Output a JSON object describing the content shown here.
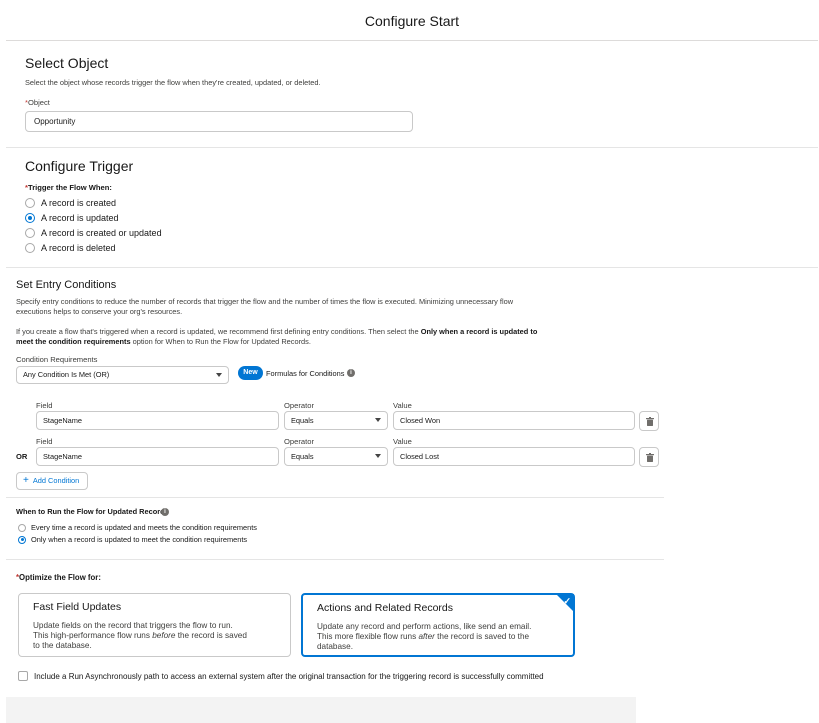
{
  "header": {
    "title": "Configure Start"
  },
  "select_object": {
    "title": "Select Object",
    "description": "Select the object whose records trigger the flow when they're created, updated, or deleted.",
    "object_label": "Object",
    "required_marker": "*",
    "object_value": "Opportunity"
  },
  "configure_trigger": {
    "title": "Configure Trigger",
    "label": "Trigger the Flow When:",
    "required_marker": "*",
    "options": [
      {
        "label": "A record is created",
        "selected": false
      },
      {
        "label": "A record is updated",
        "selected": true
      },
      {
        "label": "A record is created or updated",
        "selected": false
      },
      {
        "label": "A record is deleted",
        "selected": false
      }
    ]
  },
  "entry_conditions": {
    "title": "Set Entry Conditions",
    "desc1_line1": "Specify entry conditions to reduce the number of records that trigger the flow and the number of times the flow is executed. Minimizing unnecessary flow",
    "desc1_line2": "executions helps to conserve your org's resources.",
    "desc2_line1_pre": "If you create a flow that's triggered when a record is updated, we recommend first defining entry conditions. Then select the ",
    "desc2_line1_bold": "Only when a record is updated to",
    "desc2_line2_bold": "meet the condition requirements",
    "desc2_line2_post": " option for When to Run the Flow for Updated Records.",
    "requirements_label": "Condition Requirements",
    "requirements_value": "Any Condition Is Met (OR)",
    "new_badge": "New",
    "formulas_label": "Formulas for Conditions",
    "info_icon": "i",
    "field_label": "Field",
    "operator_label": "Operator",
    "value_label": "Value",
    "conditions": [
      {
        "field": "StageName",
        "operator": "Equals",
        "value": "Closed Won",
        "prefix": ""
      },
      {
        "field": "StageName",
        "operator": "Equals",
        "value": "Closed Lost",
        "prefix": "OR"
      }
    ],
    "add_condition": "Add Condition",
    "add_icon": "+"
  },
  "when_to_run": {
    "title": "When to Run the Flow for Updated Records",
    "info_icon": "i",
    "options": [
      {
        "label": "Every time a record is updated and meets the condition requirements",
        "selected": false
      },
      {
        "label": "Only when a record is updated to meet the condition requirements",
        "selected": true
      }
    ]
  },
  "optimize": {
    "label": "Optimize the Flow for:",
    "required_marker": "*",
    "cards": [
      {
        "title": "Fast Field Updates",
        "line1": "Update fields on the record that triggers the flow to run.",
        "line2_pre": "This high-performance flow runs ",
        "line2_em": "before",
        "line2_post": " the record is saved",
        "line3": "to the database.",
        "selected": false
      },
      {
        "title": "Actions and Related Records",
        "line1": "Update any record and perform actions, like send an email.",
        "line2_pre": "This more flexible flow runs ",
        "line2_em": "after",
        "line2_post": " the record is saved to the",
        "line3": "database.",
        "selected": true
      }
    ],
    "check_icon": "✓"
  },
  "async": {
    "label": "Include a Run Asynchronously path to access an external system after the original transaction for the triggering record is successfully committed",
    "checked": false
  },
  "colors": {
    "brand": "#0176d3",
    "required": "#c23934",
    "border": "#c9c9c9"
  }
}
